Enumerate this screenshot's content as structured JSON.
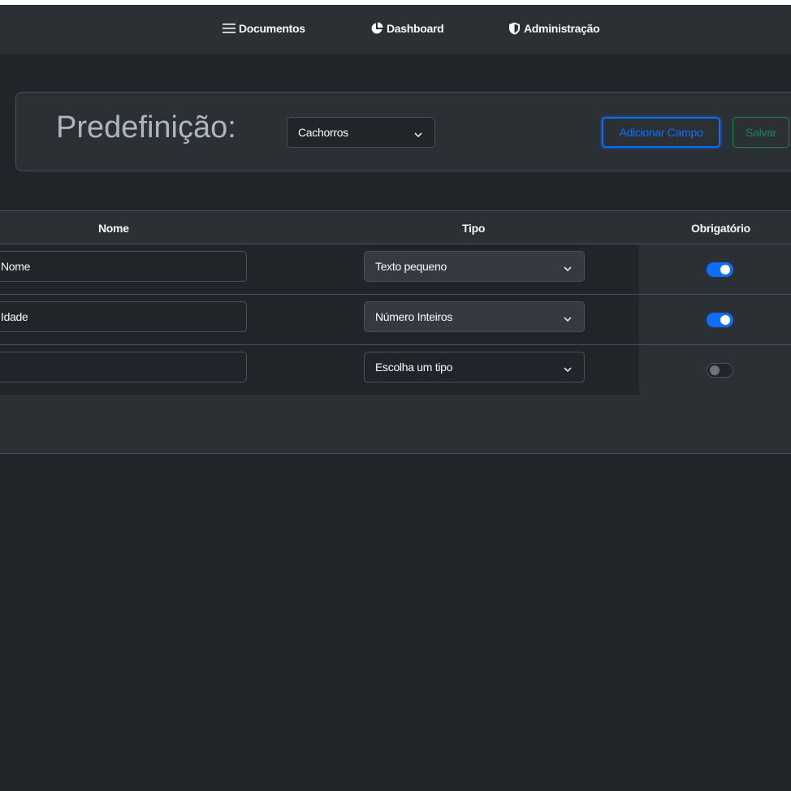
{
  "nav": {
    "items": [
      {
        "label": "Documentos",
        "icon": "list-icon"
      },
      {
        "label": "Dashboard",
        "icon": "pie-chart-icon"
      },
      {
        "label": "Administração",
        "icon": "shield-icon"
      }
    ]
  },
  "preset": {
    "title": "Predefinição:",
    "selected": "Cachorros",
    "add_button": "Adicionar Campo",
    "save_button": "Salvar"
  },
  "table": {
    "headers": {
      "name": "Nome",
      "type": "Tipo",
      "required": "Obrigatório"
    },
    "rows": [
      {
        "name": "Nome",
        "type": "Texto pequeno",
        "required": true
      },
      {
        "name": "Idade",
        "type": "Número Inteiros",
        "required": true
      },
      {
        "name": "",
        "type": "Escolha um tipo",
        "required": false
      }
    ]
  },
  "colors": {
    "background": "#212529",
    "surface": "#2b3035",
    "primary": "#0d6efd",
    "success": "#198754"
  }
}
